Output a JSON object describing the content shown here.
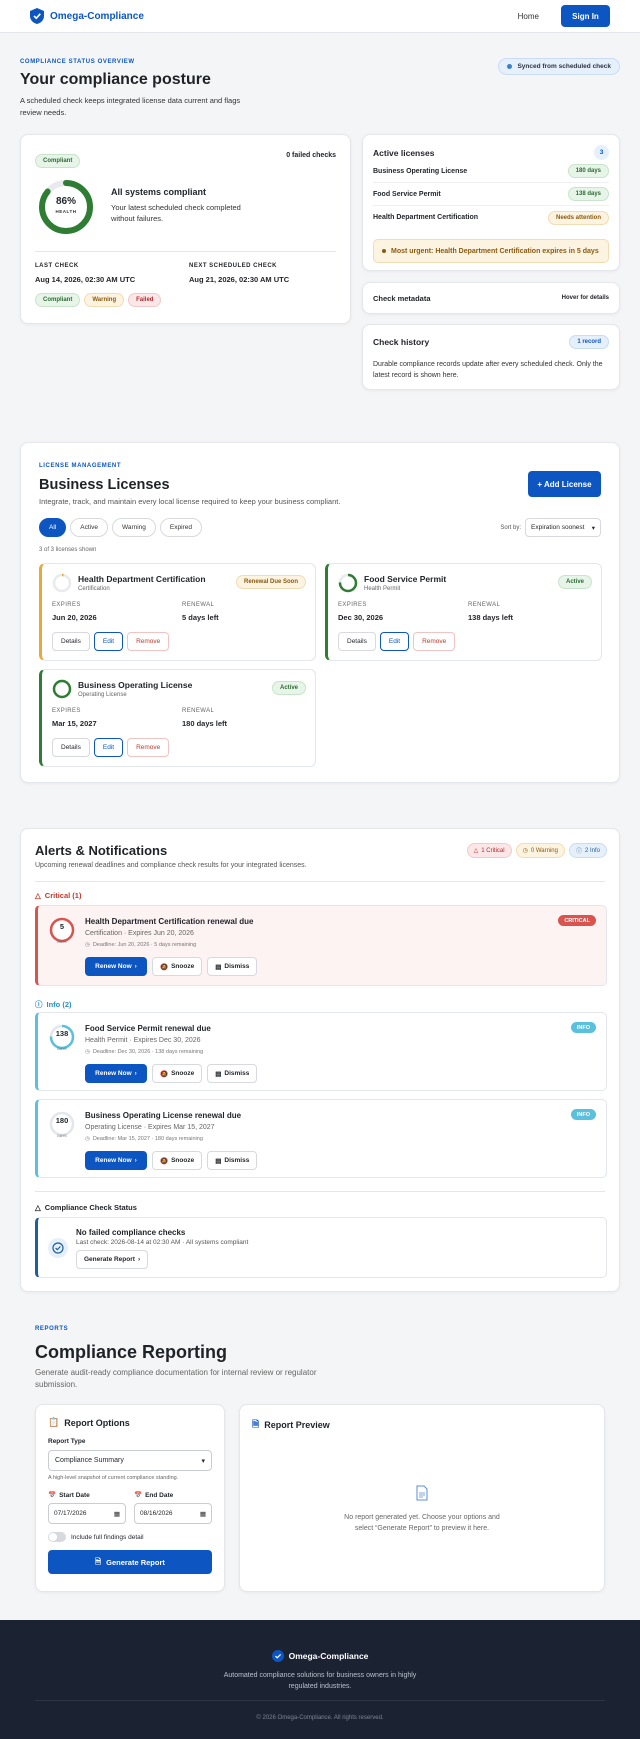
{
  "nav": {
    "brand": "Omega-Compliance",
    "home": "Home",
    "signin": "Sign In"
  },
  "hero": {
    "eyebrow": "COMPLIANCE STATUS OVERVIEW",
    "title": "Your compliance posture",
    "lead": "A scheduled check keeps integrated license data current and flags review needs.",
    "synced": "Synced from scheduled check"
  },
  "status": {
    "badge": "Compliant",
    "failed_checks": "0 failed checks",
    "health_pct": "86%",
    "health_value": 0.86,
    "health_label": "HEALTH",
    "summary_title": "All systems compliant",
    "summary_sub": "Your latest scheduled check completed without failures.",
    "last_check_label": "LAST CHECK",
    "last_check": "Aug 14, 2026, 02:30 AM UTC",
    "next_check_label": "NEXT SCHEDULED CHECK",
    "next_check": "Aug 21, 2026, 02:30 AM UTC",
    "legend": [
      "Compliant",
      "Warning",
      "Failed"
    ]
  },
  "active_licenses": {
    "title": "Active licenses",
    "count": "3",
    "items": [
      {
        "name": "Business Operating License",
        "status": "180 days"
      },
      {
        "name": "Food Service Permit",
        "status": "138 days"
      },
      {
        "name": "Health Department Certification",
        "status": "Needs attention"
      }
    ],
    "urgent": "Most urgent: Health Department Certification expires in 5 days"
  },
  "check_metadata": {
    "title": "Check metadata",
    "hint": "Hover for details"
  },
  "check_history": {
    "title": "Check history",
    "badge": "1 record",
    "text": "Durable compliance records update after every scheduled check. Only the latest record is shown here."
  },
  "licenses": {
    "eyebrow": "LICENSE MANAGEMENT",
    "title": "Business Licenses",
    "lead": "Integrate, track, and maintain every local license required to keep your business compliant.",
    "add": "+ Add License",
    "filters": [
      "All",
      "Active",
      "Warning",
      "Expired"
    ],
    "sort_label": "Sort by:",
    "sort_value": "Expiration soonest",
    "shown": "3 of 3 licenses shown",
    "expires_label": "EXPIRES",
    "renewal_label": "RENEWAL",
    "actions": {
      "details": "Details",
      "edit": "Edit",
      "remove": "Remove"
    },
    "cards": [
      {
        "name": "Health Department Certification",
        "type": "Certification",
        "status": "Renewal Due Soon",
        "expires": "Jun 20, 2026",
        "renewal": "5 days left"
      },
      {
        "name": "Food Service Permit",
        "type": "Health Permit",
        "status": "Active",
        "expires": "Dec 30, 2026",
        "renewal": "138 days left"
      },
      {
        "name": "Business Operating License",
        "type": "Operating License",
        "status": "Active",
        "expires": "Mar 15, 2027",
        "renewal": "180 days left"
      }
    ]
  },
  "alerts": {
    "title": "Alerts & Notifications",
    "lead": "Upcoming renewal deadlines and compliance check results for your integrated licenses.",
    "badges": {
      "critical": "1 Critical",
      "warning": "0 Warning",
      "info": "2 Info"
    },
    "critical_group": "Critical (1)",
    "info_group": "Info (2)",
    "days_label": "DAYS",
    "buttons": {
      "renew": "Renew Now",
      "snooze": "Snooze",
      "dismiss": "Dismiss"
    },
    "items": [
      {
        "days": "5",
        "title": "Health Department Certification renewal due",
        "sub": "Certification · Expires Jun 20, 2026",
        "deadline": "Deadline: Jun 20, 2026 · 5 days remaining",
        "tag": "CRITICAL"
      },
      {
        "days": "138",
        "title": "Food Service Permit renewal due",
        "sub": "Health Permit · Expires Dec 30, 2026",
        "deadline": "Deadline: Dec 30, 2026 · 138 days remaining",
        "tag": "INFO"
      },
      {
        "days": "180",
        "title": "Business Operating License renewal due",
        "sub": "Operating License · Expires Mar 15, 2027",
        "deadline": "Deadline: Mar 15, 2027 · 180 days remaining",
        "tag": "INFO"
      }
    ],
    "check_status_title": "Compliance Check Status",
    "check_status": {
      "title": "No failed compliance checks",
      "sub": "Last check: 2026-08-14 at 02:30 AM · All systems compliant",
      "button": "Generate Report"
    }
  },
  "reports": {
    "eyebrow": "REPORTS",
    "title": "Compliance Reporting",
    "lead": "Generate audit-ready compliance documentation for internal review or regulator submission.",
    "options_title": "Report Options",
    "type_label": "Report Type",
    "type_value": "Compliance Summary",
    "type_hint": "A high-level snapshot of current compliance standing.",
    "start_label": "Start Date",
    "start_value": "07/17/2026",
    "end_label": "End Date",
    "end_value": "08/16/2026",
    "toggle_label": "Include full findings detail",
    "generate": "Generate Report",
    "preview_title": "Report Preview",
    "preview_empty": "No report generated yet. Choose your options and select “Generate Report” to preview it here."
  },
  "footer": {
    "brand": "Omega-Compliance",
    "desc": "Automated compliance solutions for business owners in highly regulated industries.",
    "copyright": "© 2026 Omega-Compliance. All rights reserved."
  },
  "colors": {
    "primary": "#0d56c2",
    "success": "#2e7d32",
    "warning": "#e8a93a",
    "critical": "#d9534f",
    "info": "#5bc0de",
    "footer": "#1b2333"
  }
}
